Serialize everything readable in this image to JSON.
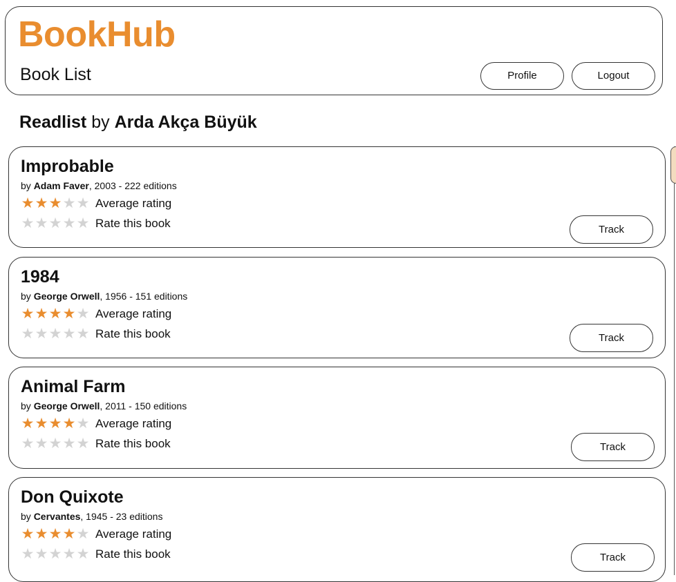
{
  "header": {
    "brand": "BookHub",
    "page_title": "Book List",
    "profile_label": "Profile",
    "logout_label": "Logout"
  },
  "readlist": {
    "prefix": "Readlist",
    "by": "by",
    "owner": "Arda Akça Büyük"
  },
  "labels": {
    "by": "by",
    "average_rating": "Average rating",
    "rate_this_book": "Rate this book",
    "track": "Track"
  },
  "colors": {
    "brand": "#e98d2f",
    "star_filled": "#e98d2f",
    "star_empty": "#d3d3d3"
  },
  "books": [
    {
      "title": "Improbable",
      "author": "Adam Faver",
      "details": ", 2003 - 222 editions",
      "average_rating": 3,
      "user_rating": 0
    },
    {
      "title": "1984",
      "author": "George Orwell",
      "details": ", 1956 - 151 editions",
      "average_rating": 4,
      "user_rating": 0
    },
    {
      "title": "Animal Farm",
      "author": "George Orwell",
      "details": ", 2011 - 150 editions",
      "average_rating": 4,
      "user_rating": 0
    },
    {
      "title": "Don Quixote",
      "author": "Cervantes",
      "details": ", 1945 - 23 editions",
      "average_rating": 4,
      "user_rating": 0
    }
  ]
}
